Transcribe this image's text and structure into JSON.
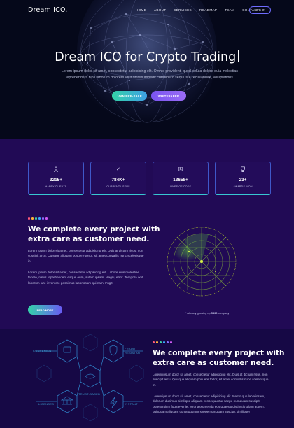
{
  "header": {
    "logo": "Dream ICO.",
    "nav": [
      "HOME",
      "ABOUT",
      "SERVICES",
      "ROADMAP",
      "TEAM",
      "CONTACT"
    ],
    "login_label": "LOG IN"
  },
  "hero": {
    "title": "Dream ICO for Crypto Trading",
    "subtitle": "Lorem ipsum dolor sit amet, consectetur adipisicing elit. Omnis provident, quod soluta dolore quia molestias reprehenderit nihil laborum dolorem velit officiis impedit cum libero sequi iste recusandae, voluptatibus.",
    "presale_label": "JOIN PRE-SALE",
    "whitepaper_label": "WHITEPAPER"
  },
  "stats": [
    {
      "icon": "user-icon",
      "glyph": "♀",
      "value": "3215+",
      "label": "HAPPY CLIENTS"
    },
    {
      "icon": "check-icon",
      "glyph": "✓",
      "value": "784K+",
      "label": "CURRENT USERS"
    },
    {
      "icon": "code-icon",
      "glyph": "[$]",
      "value": "13658+",
      "label": "LINES OF CODE"
    },
    {
      "icon": "trophy-icon",
      "glyph": "♡",
      "value": "23+",
      "label": "AWARDS WON"
    }
  ],
  "section_two": {
    "heading_line1": "We complete every project with",
    "heading_line2": "extra care as customer need.",
    "para1": "Lorem ipsum dolor sit amet, consectetur adipisicing elit. Duis at dictum risus, non suscipit arcu. Quisque aliquam posuere tortor, sit amet convallis nunc scelerisque in.",
    "para2": "Lorem ipsum dolor sit amet, consectetur adipisicing elit. Labore eius molestiae facere, natus reprehenderit eaque eum, autem ipsam. Magni, error. Tempora odit laborum iure inventore possimus laboriosam qui nam. Fugit!",
    "read_more_label": "READ MORE",
    "caption_prefix": "* Already growing up",
    "caption_value": "5336",
    "caption_suffix": "company"
  },
  "section_three": {
    "hex_labels": [
      "CONVENIENT",
      "FRAUD RESISTANT",
      "TRUST-BASED",
      "LICENSED",
      "INSTANT"
    ],
    "heading_line1": "We complete every project with",
    "heading_line2": "extra care as customer need.",
    "para1": "Lorem ipsum dolor sit amet, consectetur adipisicing elit. Duis at dictum risus, non suscipit arcu. Quisque aliquam posuere tortor, sit amet convallis nunc scelerisque in.",
    "para2": "Lorem ipsum dolor sit amet, consectetur adipisicing elit. Nemo quo laboriosam, dolorum ducimus similique aliquam consequuntur saepe numquam suscipit praesentium fuga eveniet error assumenda eos quaerat distinctio ullam autem, quisquam aliquam consequuntur saepe numquam suscipit similique!"
  },
  "colors": {
    "background": "#210a55",
    "accent_teal": "#34d2a8",
    "accent_purple": "#7a55f0",
    "radar_green": "#63d43a",
    "hex_blue": "#2f7fc4",
    "dot_palette": [
      "#ff5a7a",
      "#ffb13b",
      "#3ed0a0",
      "#3aa8ff",
      "#8a6cff",
      "#d05af5"
    ]
  }
}
